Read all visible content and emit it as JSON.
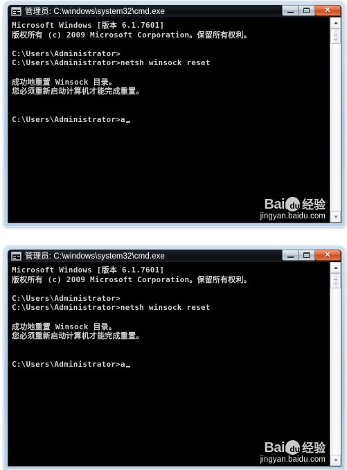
{
  "window": {
    "title": "管理员: C:\\windows\\system32\\cmd.exe",
    "icon": "console-icon",
    "buttons": {
      "minimize_label": "",
      "maximize_label": "",
      "close_label": "✕"
    }
  },
  "console": {
    "lines": [
      "Microsoft Windows [版本 6.1.7601]",
      "版权所有 (c) 2009 Microsoft Corporation。保留所有权利。",
      "",
      "C:\\Users\\Administrator>",
      "C:\\Users\\Administrator>netsh winsock reset",
      "",
      "成功地重置 Winsock 目录。",
      "您必须重新启动计算机才能完成重置。",
      "",
      ""
    ],
    "prompt_line": "C:\\Users\\Administrator>a",
    "text_color": "#cccccc",
    "background_color": "#000000"
  },
  "watermark": {
    "brand_bai": "Bai",
    "brand_du": "du",
    "brand_jingyan": "经验",
    "url": "jingyan.baidu.com"
  },
  "scrollbar": {
    "up_arrow": "scroll-up-arrow",
    "down_arrow": "scroll-down-arrow",
    "thumb": "scroll-thumb"
  },
  "windows": [
    {
      "id": "window-top"
    },
    {
      "id": "window-bottom"
    }
  ]
}
